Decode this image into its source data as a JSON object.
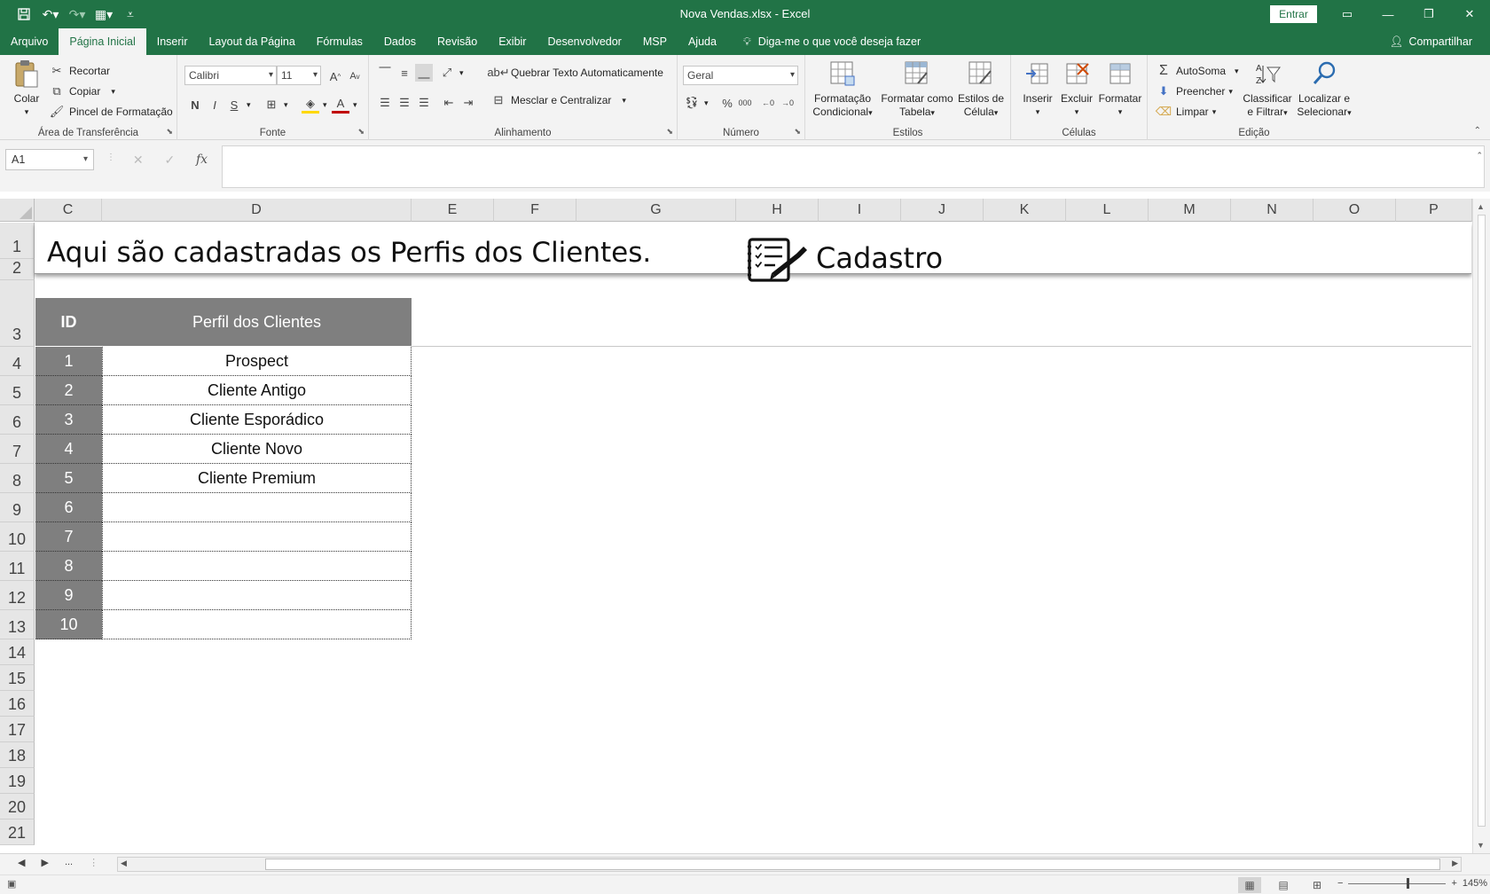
{
  "window": {
    "title": "Nova Vendas.xlsx  -  Excel",
    "signin_label": "Entrar"
  },
  "menu": {
    "tabs": [
      "Arquivo",
      "Página Inicial",
      "Inserir",
      "Layout da Página",
      "Fórmulas",
      "Dados",
      "Revisão",
      "Exibir",
      "Desenvolvedor",
      "MSP",
      "Ajuda"
    ],
    "active_tab": "Página Inicial",
    "tell_me": "Diga-me o que você deseja fazer",
    "share": "Compartilhar"
  },
  "ribbon": {
    "clipboard": {
      "label": "Área de Transferência",
      "paste": "Colar",
      "cut": "Recortar",
      "copy": "Copiar",
      "format_painter": "Pincel de Formatação"
    },
    "font": {
      "label": "Fonte",
      "font_name": "Calibri",
      "font_size": "11",
      "bold": "N",
      "italic": "I",
      "underline": "S"
    },
    "alignment": {
      "label": "Alinhamento",
      "wrap_text": "Quebrar Texto Automaticamente",
      "merge_center": "Mesclar e Centralizar"
    },
    "number": {
      "label": "Número",
      "format": "Geral",
      "percent": "%",
      "thousands": "000"
    },
    "styles": {
      "label": "Estilos",
      "conditional_line1": "Formatação",
      "conditional_line2": "Condicional",
      "format_table_line1": "Formatar como",
      "format_table_line2": "Tabela",
      "cell_styles_line1": "Estilos de",
      "cell_styles_line2": "Célula"
    },
    "cells": {
      "label": "Células",
      "insert": "Inserir",
      "delete": "Excluir",
      "format": "Formatar"
    },
    "editing": {
      "label": "Edição",
      "autosum": "AutoSoma",
      "fill": "Preencher",
      "clear": "Limpar",
      "sort_line1": "Classificar",
      "sort_line2": "e Filtrar",
      "find_line1": "Localizar e",
      "find_line2": "Selecionar"
    }
  },
  "formula_bar": {
    "name_box": "A1",
    "fx": "fx",
    "formula": ""
  },
  "sheet": {
    "columns": [
      "C",
      "D",
      "E",
      "F",
      "G",
      "H",
      "I",
      "J",
      "K",
      "L",
      "M",
      "N",
      "O",
      "P"
    ],
    "rows": [
      "1",
      "2",
      "3",
      "4",
      "5",
      "6",
      "7",
      "8",
      "9",
      "10",
      "11",
      "12",
      "13",
      "14",
      "15",
      "16",
      "17",
      "18",
      "19",
      "20",
      "21"
    ],
    "banner_text": "Aqui são cadastradas os Perfis dos Clientes.",
    "banner_icon": "checklist-pen-icon",
    "banner_label": "Cadastro",
    "table": {
      "header_id": "ID",
      "header_name": "Perfil dos Clientes",
      "rows": [
        {
          "id": "1",
          "name": "Prospect"
        },
        {
          "id": "2",
          "name": "Cliente Antigo"
        },
        {
          "id": "3",
          "name": "Cliente Esporádico"
        },
        {
          "id": "4",
          "name": "Cliente Novo"
        },
        {
          "id": "5",
          "name": "Cliente Premium"
        },
        {
          "id": "6",
          "name": ""
        },
        {
          "id": "7",
          "name": ""
        },
        {
          "id": "8",
          "name": ""
        },
        {
          "id": "9",
          "name": ""
        },
        {
          "id": "10",
          "name": ""
        }
      ]
    }
  },
  "status": {
    "sheet_nav_more": "...",
    "zoom": "145%"
  },
  "colors": {
    "excel_green": "#217346",
    "table_header_gray": "#7f7f7f"
  }
}
